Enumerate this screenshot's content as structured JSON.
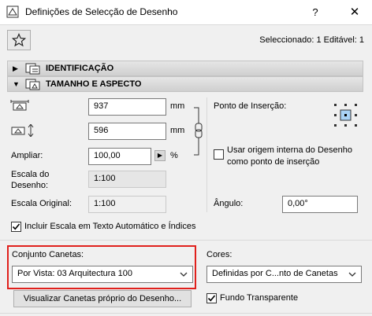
{
  "window": {
    "title": "Definições de Selecção de Desenho",
    "help": "?",
    "close": "✕"
  },
  "header": {
    "selected": "Seleccionado: 1 Editável: 1"
  },
  "sections": {
    "identification": "IDENTIFICAÇÃO",
    "size": "TAMANHO E ASPECTO"
  },
  "size": {
    "width_value": "937",
    "width_unit": "mm",
    "height_value": "596",
    "height_unit": "mm",
    "magnify_label": "Ampliar:",
    "magnify_value": "100,00",
    "magnify_unit": "%",
    "scale_label": "Escala do Desenho:",
    "scale_value": "1:100",
    "orig_scale_label": "Escala Original:",
    "orig_scale_value": "1:100",
    "anchor_label": "Ponto de Inserção:",
    "use_origin_label": "Usar origem interna do Desenho como ponto de inserção",
    "angle_label": "Ângulo:",
    "angle_value": "0,00°",
    "include_scale_label": "Incluir Escala em Texto Automático e Índices"
  },
  "pens": {
    "pen_set_label": "Conjunto Canetas:",
    "pen_set_value": "Por Vista: 03 Arquitectura 100",
    "colors_label": "Cores:",
    "colors_value": "Definidas por C...nto de Canetas",
    "view_pens_button": "Visualizar Canetas próprio do Desenho...",
    "transparent_label": "Fundo Transparente"
  }
}
